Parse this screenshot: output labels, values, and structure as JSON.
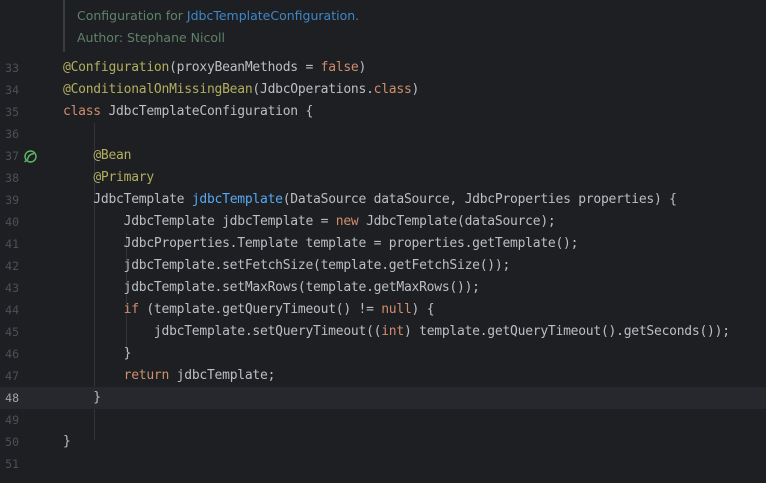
{
  "doc": {
    "prefix": "Configuration for ",
    "link": "JdbcTemplateConfiguration",
    "suffix": ".",
    "author": "Author: Stephane Nicoll"
  },
  "gutter_icon": "bean-icon",
  "current_line": "48",
  "lines": [
    {
      "num": "33",
      "tokens": [
        [
          "ann",
          "@Configuration"
        ],
        [
          "cls",
          "(proxyBeanMethods = "
        ],
        [
          "kw",
          "false"
        ],
        [
          "cls",
          ")"
        ]
      ]
    },
    {
      "num": "34",
      "tokens": [
        [
          "ann",
          "@ConditionalOnMissingBean"
        ],
        [
          "cls",
          "(JdbcOperations."
        ],
        [
          "kw",
          "class"
        ],
        [
          "cls",
          ")"
        ]
      ]
    },
    {
      "num": "35",
      "tokens": [
        [
          "kw",
          "class"
        ],
        [
          "cls",
          " JdbcTemplateConfiguration {"
        ]
      ]
    },
    {
      "num": "36",
      "tokens": []
    },
    {
      "num": "37",
      "tokens": [
        [
          "cls",
          "    "
        ],
        [
          "ann",
          "@Bean"
        ]
      ]
    },
    {
      "num": "38",
      "tokens": [
        [
          "cls",
          "    "
        ],
        [
          "ann",
          "@Primary"
        ]
      ]
    },
    {
      "num": "39",
      "tokens": [
        [
          "cls",
          "    JdbcTemplate "
        ],
        [
          "fn",
          "jdbcTemplate"
        ],
        [
          "cls",
          "(DataSource dataSource, JdbcProperties properties) {"
        ]
      ]
    },
    {
      "num": "40",
      "tokens": [
        [
          "cls",
          "        JdbcTemplate jdbcTemplate = "
        ],
        [
          "kw",
          "new"
        ],
        [
          "cls",
          " JdbcTemplate(dataSource);"
        ]
      ]
    },
    {
      "num": "41",
      "tokens": [
        [
          "cls",
          "        JdbcProperties.Template template = properties.getTemplate();"
        ]
      ]
    },
    {
      "num": "42",
      "tokens": [
        [
          "cls",
          "        jdbcTemplate.setFetchSize(template.getFetchSize());"
        ]
      ]
    },
    {
      "num": "43",
      "tokens": [
        [
          "cls",
          "        jdbcTemplate.setMaxRows(template.getMaxRows());"
        ]
      ]
    },
    {
      "num": "44",
      "tokens": [
        [
          "cls",
          "        "
        ],
        [
          "kw",
          "if"
        ],
        [
          "cls",
          " (template.getQueryTimeout() != "
        ],
        [
          "kw",
          "null"
        ],
        [
          "cls",
          ") {"
        ]
      ]
    },
    {
      "num": "45",
      "tokens": [
        [
          "cls",
          "            jdbcTemplate.setQueryTimeout(("
        ],
        [
          "kw",
          "int"
        ],
        [
          "cls",
          ") template.getQueryTimeout().getSeconds());"
        ]
      ]
    },
    {
      "num": "46",
      "tokens": [
        [
          "cls",
          "        }"
        ]
      ]
    },
    {
      "num": "47",
      "tokens": [
        [
          "cls",
          "        "
        ],
        [
          "kw",
          "return"
        ],
        [
          "cls",
          " jdbcTemplate;"
        ]
      ]
    },
    {
      "num": "48",
      "tokens": [
        [
          "cls",
          "    }"
        ]
      ]
    },
    {
      "num": "49",
      "tokens": []
    },
    {
      "num": "50",
      "tokens": [
        [
          "cls",
          "}"
        ]
      ]
    },
    {
      "num": "51",
      "tokens": []
    }
  ],
  "colors": {
    "background": "#1e1f22",
    "annotation": "#b3ae60",
    "keyword": "#cf8e6d",
    "method_declaration": "#56a8f5",
    "text": "#bcbec4",
    "doc_comment": "#5f826b",
    "doc_link": "#3d87c9",
    "line_number": "#4b5059",
    "gutter_icon": "#5fb865"
  }
}
